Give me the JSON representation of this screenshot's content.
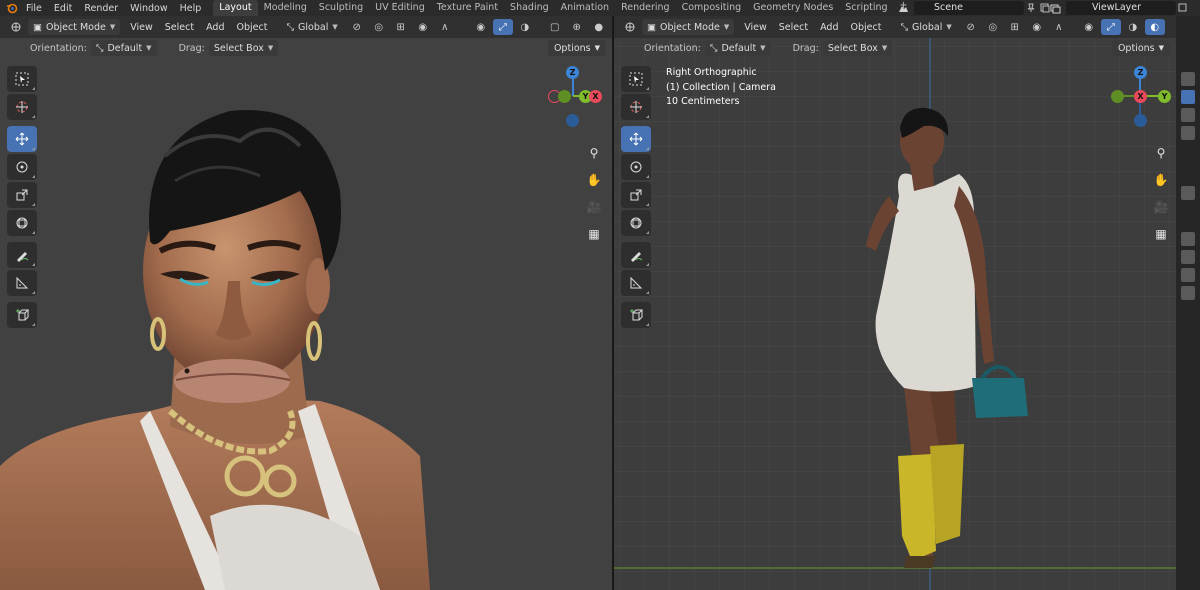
{
  "menu": {
    "items": [
      "File",
      "Edit",
      "Render",
      "Window",
      "Help"
    ]
  },
  "workspaces": {
    "tabs": [
      "Layout",
      "Modeling",
      "Sculpting",
      "UV Editing",
      "Texture Paint",
      "Shading",
      "Animation",
      "Rendering",
      "Compositing",
      "Geometry Nodes",
      "Scripting"
    ],
    "active": "Layout",
    "add": "+"
  },
  "scene": {
    "label": "Scene"
  },
  "view_layer": {
    "label": "ViewLayer"
  },
  "left_viewport": {
    "mode": "Object Mode",
    "menus": [
      "View",
      "Select",
      "Add",
      "Object"
    ],
    "transform": "Global",
    "orientation_label": "Orientation:",
    "orientation_value": "Default",
    "drag_label": "Drag:",
    "drag_value": "Select Box",
    "options": "Options"
  },
  "right_viewport": {
    "mode": "Object Mode",
    "menus": [
      "View",
      "Select",
      "Add",
      "Object"
    ],
    "transform": "Global",
    "orientation_label": "Orientation:",
    "orientation_value": "Default",
    "drag_label": "Drag:",
    "drag_value": "Select Box",
    "options": "Options",
    "overlay": {
      "view": "Right Orthographic",
      "collection": "(1) Collection | Camera",
      "scale": "10 Centimeters"
    }
  },
  "gizmo_left": {
    "z": "Z",
    "y": "Y",
    "x": "X"
  },
  "gizmo_right": {
    "z": "Z",
    "y": "Y",
    "x": "X"
  },
  "colors": {
    "accent": "#4772b3",
    "axis_x": "#e84a5a",
    "axis_y": "#7fbb2b",
    "axis_z": "#3b84d6"
  }
}
